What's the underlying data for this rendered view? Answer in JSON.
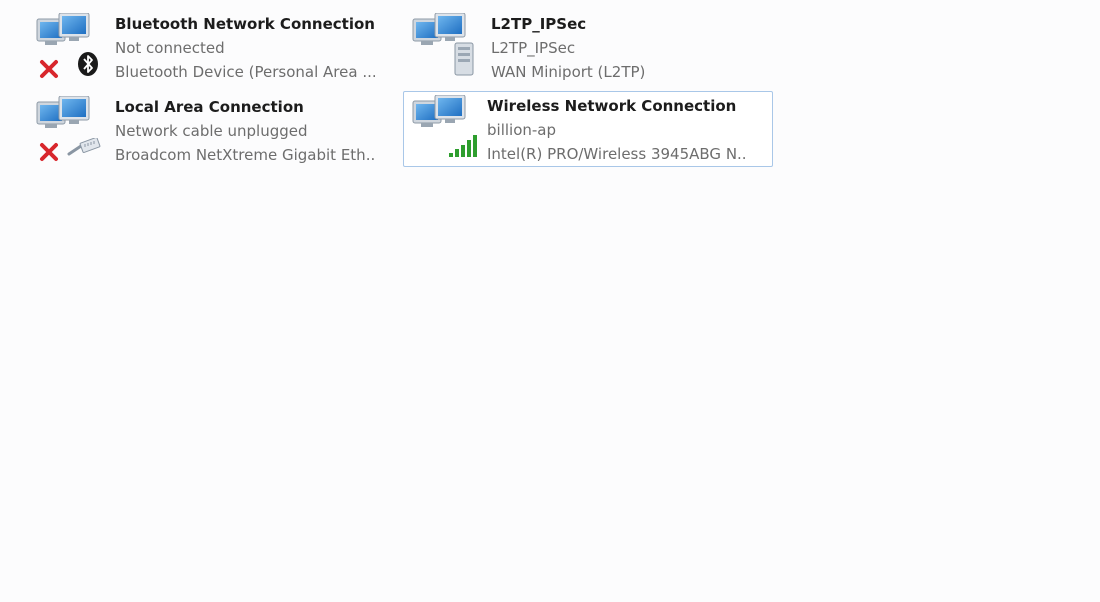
{
  "connections": [
    {
      "name": "Bluetooth Network Connection",
      "status": "Not connected",
      "device": "Bluetooth Device (Personal Area ...",
      "icon": "bluetooth-icon",
      "overlay": "red-x-icon",
      "selected": false
    },
    {
      "name": "L2TP_IPSec",
      "status": "L2TP_IPSec",
      "device": "WAN Miniport (L2TP)",
      "icon": "server-icon",
      "selected": false
    },
    {
      "name": "Local Area Connection",
      "status": "Network cable unplugged",
      "device": "Broadcom NetXtreme Gigabit Eth...",
      "icon": "ethernet-cable-icon",
      "overlay": "red-x-icon",
      "selected": false
    },
    {
      "name": "Wireless Network Connection",
      "status": "billion-ap",
      "device": "Intel(R) PRO/Wireless 3945ABG N...",
      "icon": "wifi-signal-icon",
      "selected": true
    }
  ],
  "colors": {
    "selection_border": "#a9c7e8",
    "red_x": "#d8262c",
    "signal_green": "#2e9e2e"
  }
}
